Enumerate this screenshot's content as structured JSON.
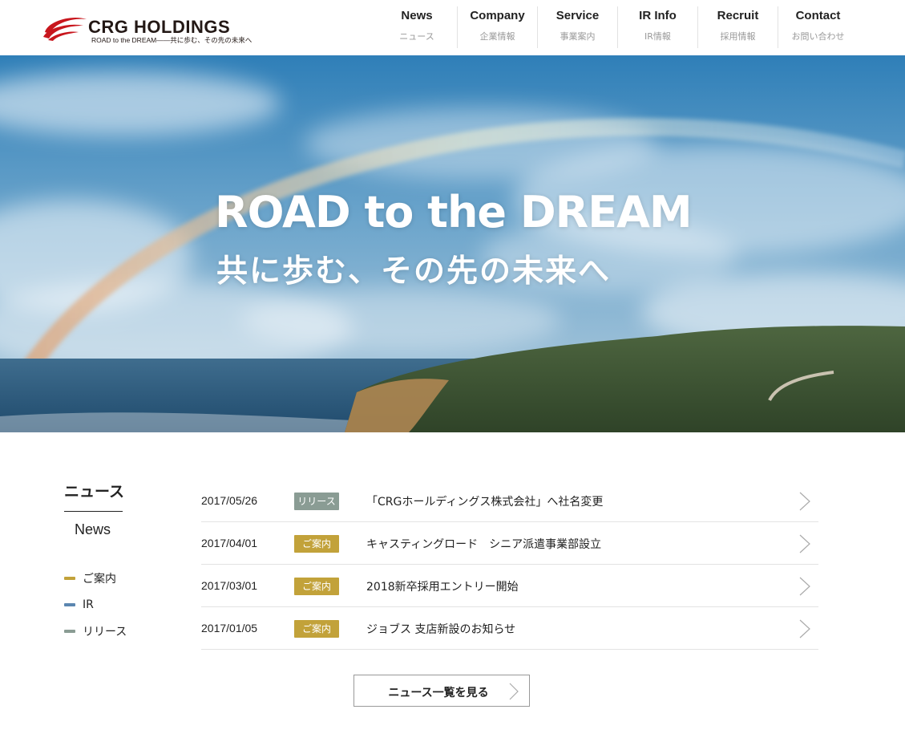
{
  "brand": {
    "name": "CRG HOLDINGS",
    "tagline": "ROAD to the DREAM——共に歩む、その先の未来へ",
    "logo_color": "#c8161d"
  },
  "nav": [
    {
      "en": "News",
      "ja": "ニュース"
    },
    {
      "en": "Company",
      "ja": "企業情報"
    },
    {
      "en": "Service",
      "ja": "事業案内"
    },
    {
      "en": "IR Info",
      "ja": "IR情報"
    },
    {
      "en": "Recruit",
      "ja": "採用情報"
    },
    {
      "en": "Contact",
      "ja": "お問い合わせ"
    }
  ],
  "hero": {
    "title": "ROAD to the DREAM",
    "subtitle": "共に歩む、その先の未来へ"
  },
  "news": {
    "heading_ja": "ニュース",
    "heading_en": "News",
    "categories": [
      {
        "label": "ご案内",
        "color": "#c2a23a"
      },
      {
        "label": "IR",
        "color": "#5b86b0"
      },
      {
        "label": "リリース",
        "color": "#8a9c94"
      }
    ],
    "items": [
      {
        "date": "2017/05/26",
        "category": "リリース",
        "category_color": "#8a9c94",
        "title": "「CRGホールディングス株式会社」へ社名変更"
      },
      {
        "date": "2017/04/01",
        "category": "ご案内",
        "category_color": "#c2a23a",
        "title": "キャスティングロード　シニア派遣事業部設立"
      },
      {
        "date": "2017/03/01",
        "category": "ご案内",
        "category_color": "#c2a23a",
        "title": "2018新卒採用エントリー開始"
      },
      {
        "date": "2017/01/05",
        "category": "ご案内",
        "category_color": "#c2a23a",
        "title": "ジョブス 支店新設のお知らせ"
      }
    ],
    "more_label": "ニュース一覧を見る"
  }
}
